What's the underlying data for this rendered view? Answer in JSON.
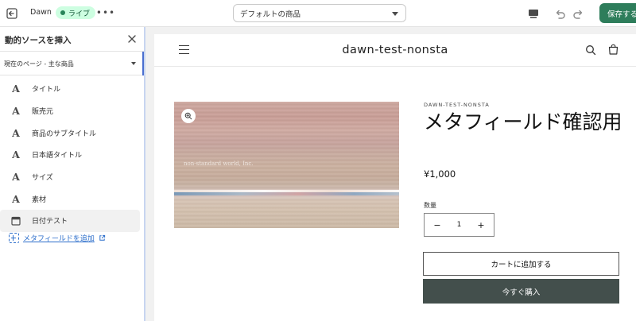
{
  "topbar": {
    "theme_name": "Dawn",
    "live_badge": "ライブ",
    "more": "•••",
    "template_select_value": "デフォルトの商品",
    "save_label": "保存する"
  },
  "panel": {
    "title": "動的ソースを挿入",
    "scope_select_value": "現在のページ - 主な商品",
    "items": [
      {
        "label": "タイトル",
        "icon": "text-A-icon"
      },
      {
        "label": "販売元",
        "icon": "text-A-icon"
      },
      {
        "label": "商品のサブタイトル",
        "icon": "text-A-icon"
      },
      {
        "label": "日本語タイトル",
        "icon": "text-A-icon"
      },
      {
        "label": "サイズ",
        "icon": "text-A-icon"
      },
      {
        "label": "素材",
        "icon": "text-A-icon"
      },
      {
        "label": "日付テスト",
        "icon": "calendar-icon"
      }
    ],
    "icon_glyph": "A",
    "add_metafield_label": "メタフィールドを追加"
  },
  "preview": {
    "store_name": "dawn-test-nonsta",
    "image_caption": "non-standard world, Inc.",
    "vendor": "DAWN-TEST-NONSTA",
    "product_title": "メタフィールド確認用",
    "price": "¥1,000",
    "quantity_label": "数量",
    "quantity_value": "1",
    "qty_minus": "−",
    "qty_plus": "+",
    "add_to_cart": "カートに追加する",
    "buy_now": "今すぐ購入"
  },
  "colors": {
    "save_button": "#2e7d5b",
    "live_badge_bg": "#cdfee1",
    "link": "#2c6ecb",
    "buy_button": "#434f4c"
  }
}
